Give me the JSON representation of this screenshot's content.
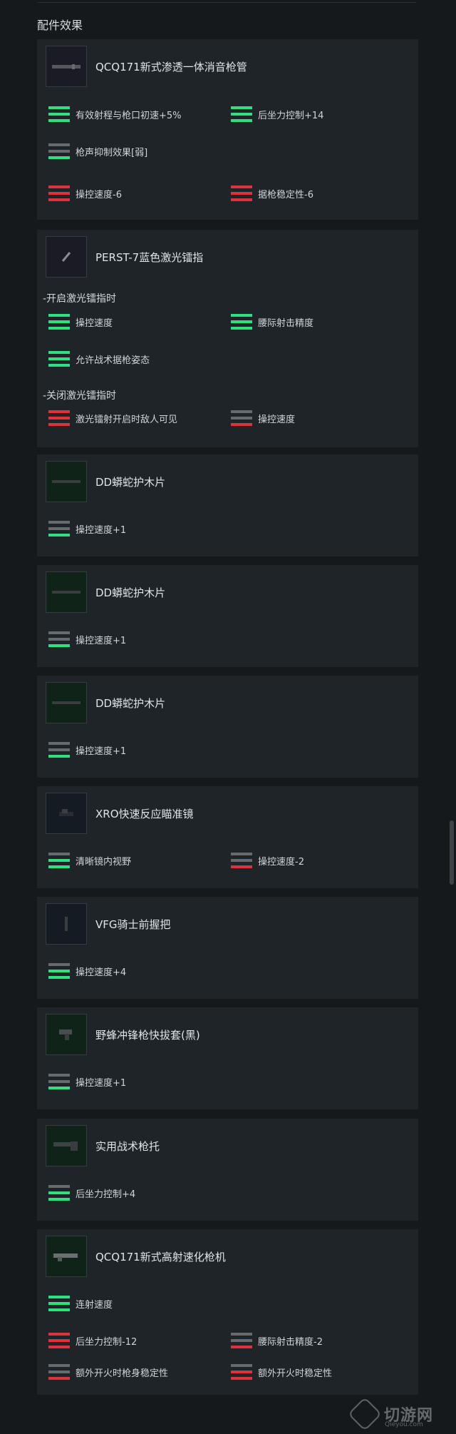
{
  "section_title": "配件效果",
  "colors": {
    "positive": "#2ee07f",
    "negative": "#e0323b",
    "neutral": "#666b70",
    "card": "#1f2428",
    "page": "#15191c"
  },
  "cards": [
    {
      "title": "QCQ171新式渗透一体消音枪管",
      "icon": "suppressor-barrel-icon",
      "stats": [
        {
          "label": "有效射程与枪口初速+5%",
          "bars": [
            "g",
            "g",
            "g"
          ]
        },
        {
          "label": "后坐力控制+14",
          "bars": [
            "g",
            "g",
            "g"
          ]
        },
        {
          "label": "枪声抑制效果[弱]",
          "bars": [
            "n",
            "n",
            "g"
          ]
        },
        {
          "label": "操控速度-6",
          "bars": [
            "r",
            "r",
            "r"
          ]
        },
        {
          "label": "据枪稳定性-6",
          "bars": [
            "r",
            "r",
            "r"
          ]
        }
      ]
    },
    {
      "title": "PERST-7蓝色激光镭指",
      "icon": "laser-pointer-icon",
      "sub1": "-开启激光镭指时",
      "sub2": "-关闭激光镭指时",
      "stats_on": [
        {
          "label": "操控速度",
          "bars": [
            "g",
            "g",
            "g"
          ]
        },
        {
          "label": "腰际射击精度",
          "bars": [
            "g",
            "g",
            "g"
          ]
        },
        {
          "label": "允许战术据枪姿态",
          "bars": [
            "g",
            "g",
            "g"
          ]
        }
      ],
      "stats_off": [
        {
          "label": "激光镭射开启时敌人可见",
          "bars": [
            "r",
            "r",
            "r"
          ]
        },
        {
          "label": "操控速度",
          "bars": [
            "n",
            "n",
            "r"
          ]
        }
      ]
    },
    {
      "title": "DD蟒蛇护木片",
      "icon": "handguard-panel-icon",
      "stats": [
        {
          "label": "操控速度+1",
          "bars": [
            "n",
            "n",
            "g"
          ]
        }
      ]
    },
    {
      "title": "DD蟒蛇护木片",
      "icon": "handguard-panel-icon",
      "stats": [
        {
          "label": "操控速度+1",
          "bars": [
            "n",
            "n",
            "g"
          ]
        }
      ]
    },
    {
      "title": "DD蟒蛇护木片",
      "icon": "handguard-panel-icon",
      "stats": [
        {
          "label": "操控速度+1",
          "bars": [
            "n",
            "n",
            "g"
          ]
        }
      ]
    },
    {
      "title": "XRO快速反应瞄准镜",
      "icon": "red-dot-sight-icon",
      "stats": [
        {
          "label": "清晰镜内视野",
          "bars": [
            "n",
            "g",
            "g"
          ]
        },
        {
          "label": "操控速度-2",
          "bars": [
            "n",
            "n",
            "r"
          ]
        }
      ]
    },
    {
      "title": "VFG骑士前握把",
      "icon": "vertical-grip-icon",
      "stats": [
        {
          "label": "操控速度+4",
          "bars": [
            "n",
            "g",
            "g"
          ]
        }
      ]
    },
    {
      "title": "野蜂冲锋枪快拔套(黑)",
      "icon": "quickdraw-holster-icon",
      "stats": [
        {
          "label": "操控速度+1",
          "bars": [
            "n",
            "n",
            "g"
          ]
        }
      ]
    },
    {
      "title": "实用战术枪托",
      "icon": "tactical-stock-icon",
      "stats": [
        {
          "label": "后坐力控制+4",
          "bars": [
            "n",
            "g",
            "g"
          ]
        }
      ]
    },
    {
      "title": "QCQ171新式高射速化枪机",
      "icon": "bolt-carrier-icon",
      "stats": [
        {
          "label": "连射速度",
          "bars": [
            "g",
            "g",
            "g"
          ]
        },
        {
          "label": "后坐力控制-12",
          "bars": [
            "r",
            "r",
            "r"
          ]
        },
        {
          "label": "腰际射击精度-2",
          "bars": [
            "n",
            "n",
            "r"
          ]
        },
        {
          "label": "额外开火时枪身稳定性",
          "bars": [
            "n",
            "n",
            "r"
          ]
        },
        {
          "label": "额外开火时稳定性",
          "bars": [
            "n",
            "r",
            "r"
          ]
        }
      ]
    }
  ],
  "watermark": {
    "text": "切游网",
    "sub": "Qieyou.com"
  }
}
